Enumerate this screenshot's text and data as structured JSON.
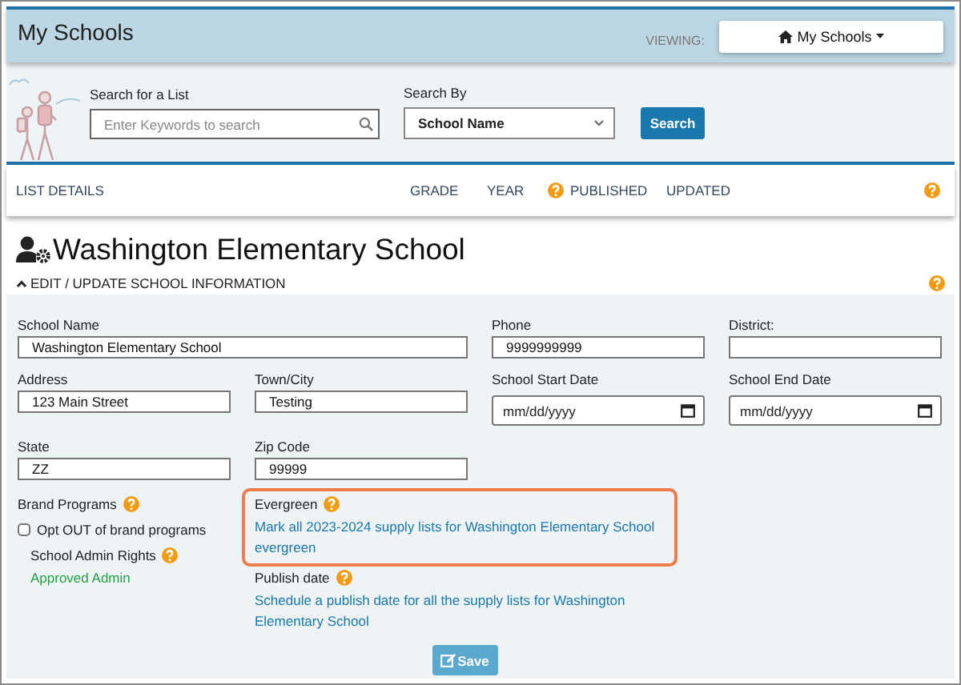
{
  "header": {
    "title": "My Schools",
    "viewing_label": "VIEWING:",
    "viewing_button": "My Schools"
  },
  "search": {
    "list_label": "Search for a List",
    "placeholder": "Enter Keywords to search",
    "by_label": "Search By",
    "by_value": "School Name",
    "button": "Search"
  },
  "list_columns": [
    {
      "label": "LIST DETAILS",
      "help": false
    },
    {
      "label": "GRADE",
      "help": false
    },
    {
      "label": "YEAR",
      "help": false
    },
    {
      "label": "PUBLISHED",
      "help": true
    },
    {
      "label": "UPDATED",
      "help": false
    }
  ],
  "school": {
    "name": "Washington Elementary School",
    "section_toggle": "EDIT / UPDATE SCHOOL INFORMATION",
    "expanded": true
  },
  "fields": [
    {
      "kind": "wide",
      "label": "School Name",
      "value": "Washington Elementary School"
    },
    {
      "kind": "text",
      "label": "Phone",
      "value": "9999999999"
    },
    {
      "kind": "text",
      "label": "District:"
    },
    {
      "kind": "text",
      "label": "Address",
      "value": "123 Main Street"
    },
    {
      "kind": "text",
      "label": "Town/City",
      "value": "Testing"
    },
    {
      "kind": "date",
      "label": "School Start Date",
      "placeholder": "mm/dd/yyyy"
    },
    {
      "kind": "date",
      "label": "School End Date",
      "placeholder": "mm/dd/yyyy"
    },
    {
      "kind": "text",
      "label": "State",
      "value": "ZZ"
    },
    {
      "kind": "text",
      "label": "Zip Code",
      "value": "99999"
    }
  ],
  "brand_programs": {
    "label": "Brand Programs",
    "option": "Opt OUT of brand programs",
    "checked": false
  },
  "admin_rights": {
    "label": "School Admin Rights",
    "status": "Approved Admin"
  },
  "evergreen": {
    "label": "Evergreen",
    "link": "Mark all 2023-2024 supply lists for Washington Elementary School evergreen",
    "highlighted": true
  },
  "publish_date": {
    "label": "Publish date",
    "link": "Schedule a publish date for all the supply lists for Washington Elementary School"
  },
  "save_button": "Save"
}
